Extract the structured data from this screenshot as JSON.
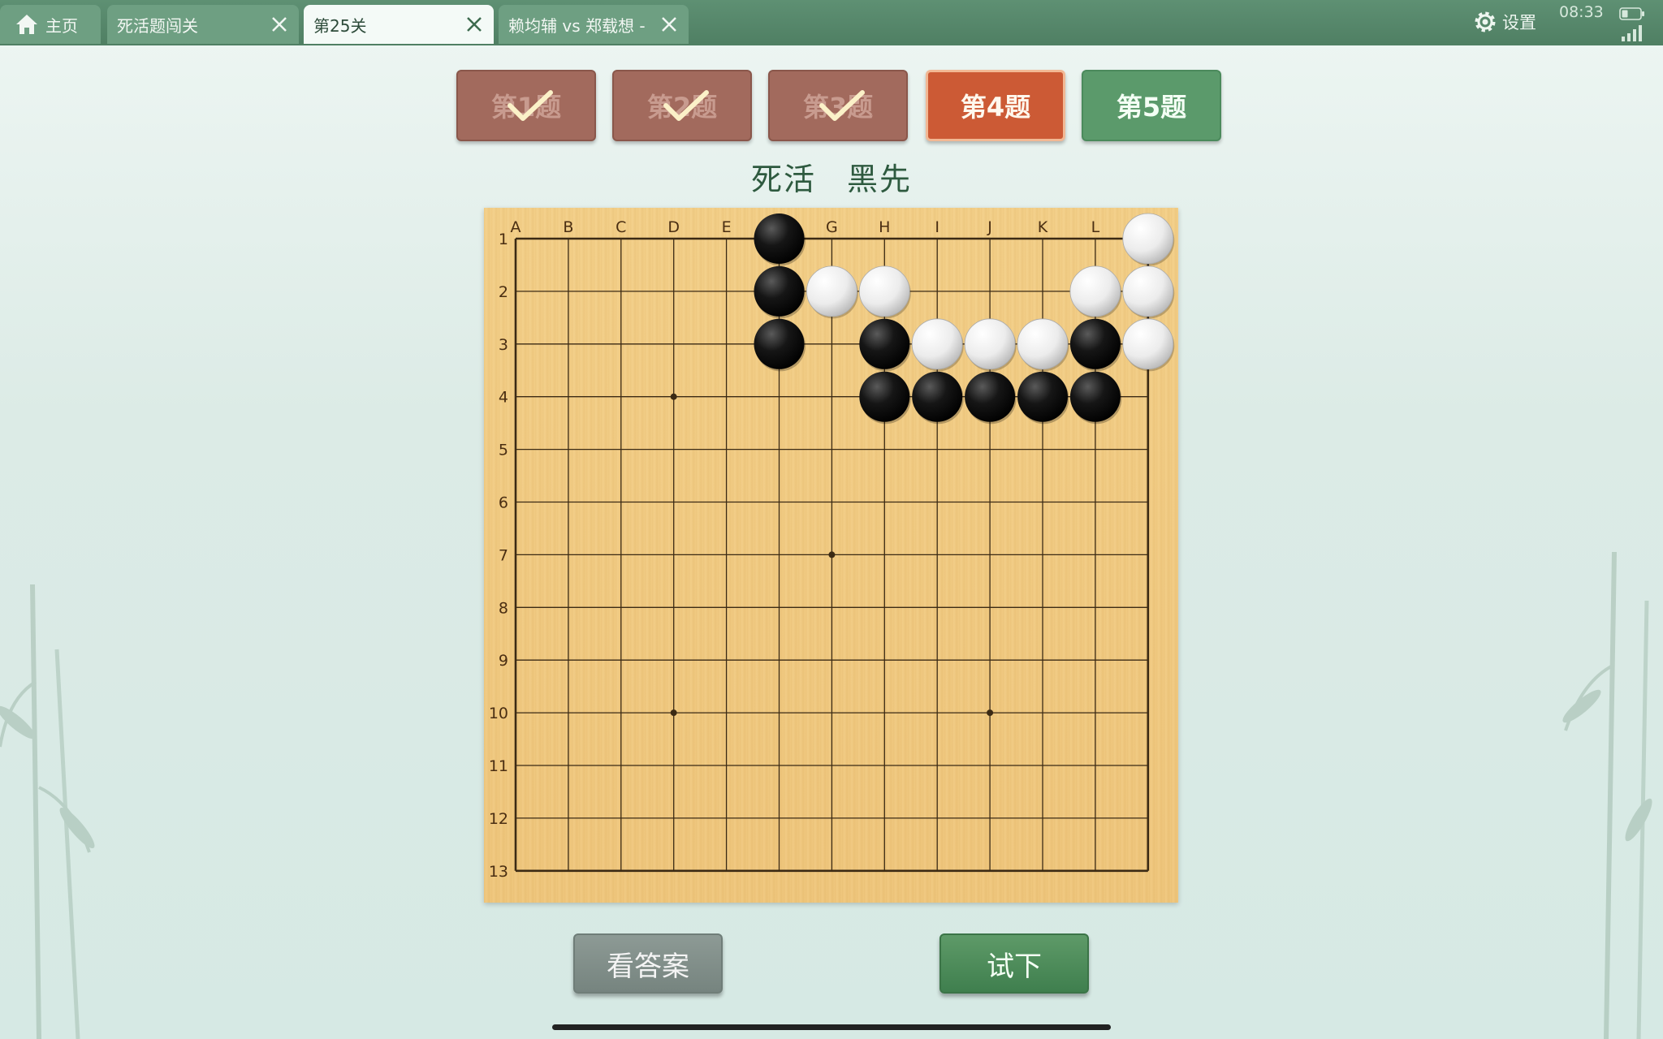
{
  "tabs": [
    {
      "label": "主页",
      "icon": "home-icon",
      "closable": false,
      "active": false
    },
    {
      "label": "死活题闯关",
      "closable": true,
      "active": false
    },
    {
      "label": "第25关",
      "closable": true,
      "active": true
    },
    {
      "label": "赖均辅 vs 郑载想 -",
      "closable": true,
      "active": false
    }
  ],
  "status": {
    "settings_label": "设置",
    "time": "08:33"
  },
  "problems": [
    {
      "label": "第1题",
      "state": "done"
    },
    {
      "label": "第2题",
      "state": "done"
    },
    {
      "label": "第3题",
      "state": "done"
    },
    {
      "label": "第4题",
      "state": "active"
    },
    {
      "label": "第5题",
      "state": "todo"
    }
  ],
  "subtitle": {
    "type": "死活",
    "to_play": "黑先"
  },
  "board": {
    "size": 13,
    "columns": [
      "A",
      "B",
      "C",
      "D",
      "E",
      "F",
      "G",
      "H",
      "I",
      "J",
      "K",
      "L",
      "M"
    ],
    "column_labels_shown": [
      "A",
      "B",
      "C",
      "D",
      "E",
      "",
      "G",
      "H",
      "I",
      "J",
      "K",
      "L",
      ""
    ],
    "rows": [
      "1",
      "2",
      "3",
      "4",
      "5",
      "6",
      "7",
      "8",
      "9",
      "10",
      "11",
      "12",
      "13"
    ],
    "star_points": [
      "D4",
      "G7",
      "D10",
      "J10"
    ],
    "black": [
      "F1",
      "F2",
      "F3",
      "H3",
      "L3",
      "H4",
      "I4",
      "J4",
      "K4",
      "L4"
    ],
    "white": [
      "M1",
      "G2",
      "H2",
      "L2",
      "M2",
      "I3",
      "J3",
      "K3",
      "M3"
    ]
  },
  "buttons": {
    "answer": "看答案",
    "try": "试下"
  },
  "colors": {
    "tabbar": "#5e9073",
    "done": "#a26a5d",
    "active": "#cc5a35",
    "todo": "#5b9a6b",
    "board": "#f0c97f"
  }
}
